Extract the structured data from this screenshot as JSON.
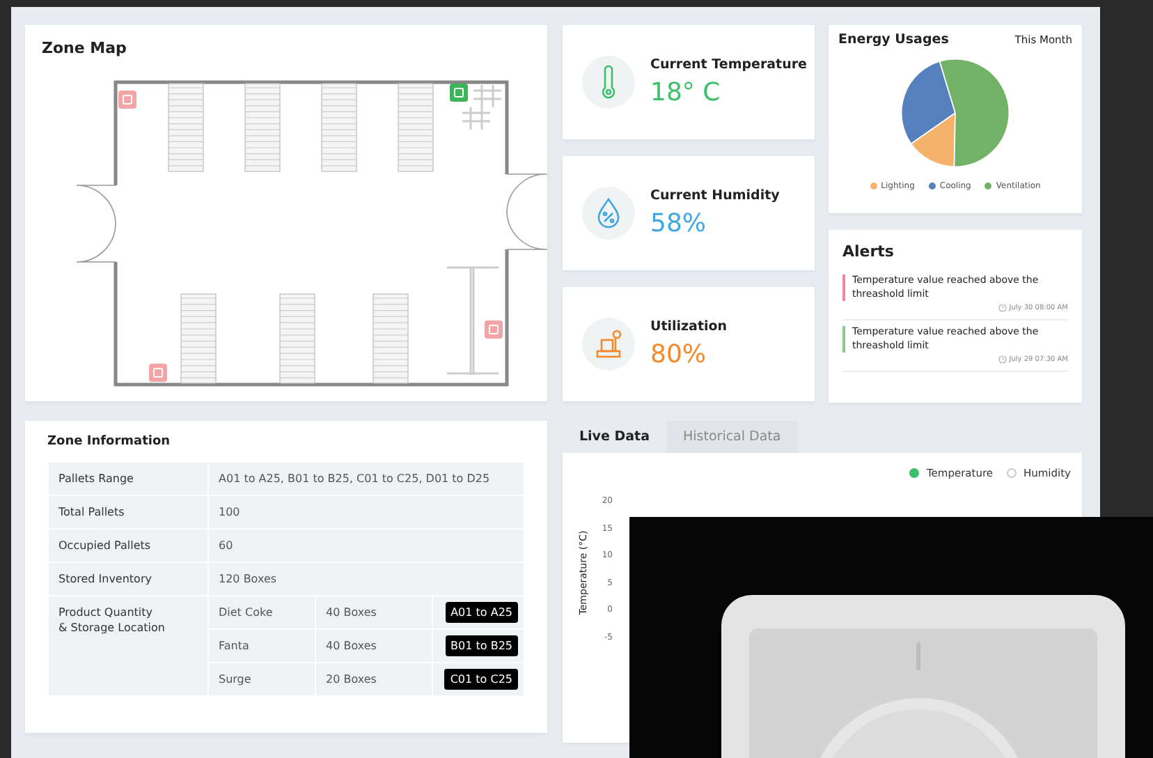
{
  "zone_map": {
    "title": "Zone Map",
    "sensors": [
      {
        "color": "#f4a3a6"
      },
      {
        "color": "#3cb55a"
      },
      {
        "color": "#f4a3a6"
      },
      {
        "color": "#f4a3a6"
      }
    ]
  },
  "metrics": [
    {
      "kind": "temperature",
      "label": "Current Temperature",
      "value": "18° C",
      "color": "#3cbf6a"
    },
    {
      "kind": "humidity",
      "label": "Current Humidity",
      "value": "58%",
      "color": "#3ea6e0"
    },
    {
      "kind": "utilization",
      "label": "Utilization",
      "value": "80%",
      "color": "#f5892a"
    }
  ],
  "energy": {
    "title": "Energy Usages",
    "period": "This Month",
    "legend": [
      {
        "label": "Lighting",
        "color": "#f5b26b"
      },
      {
        "label": "Cooling",
        "color": "#5480bd"
      },
      {
        "label": "Ventilation",
        "color": "#72b267"
      }
    ]
  },
  "alerts": {
    "title": "Alerts",
    "items": [
      {
        "text": "Temperature value reached above the threashold limit",
        "time": "July 30 08:00 AM",
        "color": "#f08a96"
      },
      {
        "text": "Temperature value reached above the threashold limit",
        "time": "July 29 07:30 AM",
        "color": "#8cc98a"
      }
    ]
  },
  "zone_info": {
    "title": "Zone Information",
    "rows": [
      {
        "label": "Pallets Range",
        "value": "A01 to A25, B01 to B25, C01 to C25, D01 to D25"
      },
      {
        "label": "Total Pallets",
        "value": "100"
      },
      {
        "label": "Occupied Pallets",
        "value": "60"
      },
      {
        "label": "Stored Inventory",
        "value": "120 Boxes"
      }
    ],
    "products_label": "Product Quantity\n& Storage Location",
    "products": [
      {
        "name": "Diet Coke",
        "quantity": "40 Boxes",
        "location": "A01 to A25"
      },
      {
        "name": "Fanta",
        "quantity": "40 Boxes",
        "location": "B01 to B25"
      },
      {
        "name": "Surge",
        "quantity": "20 Boxes",
        "location": "C01 to C25"
      }
    ]
  },
  "live": {
    "tabs": [
      {
        "label": "Live Data",
        "selected": true
      },
      {
        "label": "Historical Data",
        "selected": false
      }
    ],
    "series": [
      {
        "label": "Temperature",
        "selected": true,
        "color": "#3cbf6a"
      },
      {
        "label": "Humidity",
        "selected": false
      }
    ],
    "ylabel": "Temperature (°C)",
    "yticks": [
      "20",
      "15",
      "10",
      "5",
      "0",
      "-5"
    ]
  }
}
